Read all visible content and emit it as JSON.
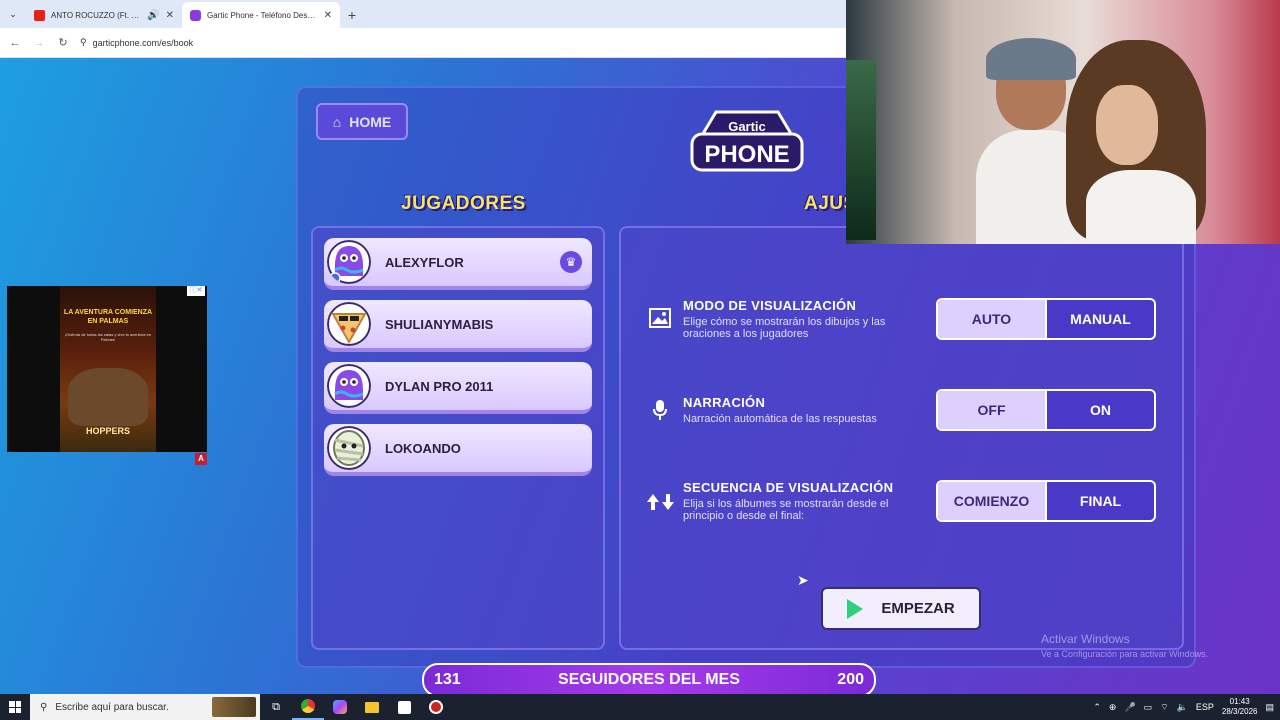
{
  "browser": {
    "tabs": [
      {
        "title": "ANTO ROCUZZO (Ft. Doble",
        "active": false,
        "icon": "youtube-icon"
      },
      {
        "title": "Gartic Phone - Teléfono Descon",
        "active": true,
        "icon": "gartic-icon"
      }
    ],
    "url": "garticphone.com/es/book"
  },
  "game": {
    "home_label": "HOME",
    "logo_line1": "Gartic",
    "logo_line2": "PHONE",
    "players_title": "JUGADORES",
    "settings_title": "AJUS",
    "players": [
      {
        "name": "ALEXYFLOR",
        "host": true
      },
      {
        "name": "SHULIANYMABIS",
        "host": false
      },
      {
        "name": "DYLAN PRO 2011",
        "host": false
      },
      {
        "name": "LOKOANDO",
        "host": false
      }
    ],
    "settings": [
      {
        "title": "MODO DE VISUALIZACIÓN",
        "desc": "Elige cómo se mostrarán los dibujos y las oraciones a los jugadores",
        "options": [
          "AUTO",
          "MANUAL"
        ],
        "selected": "AUTO"
      },
      {
        "title": "NARRACIÓN",
        "desc": "Narración automática de las respuestas",
        "options": [
          "OFF",
          "ON"
        ],
        "selected": "OFF"
      },
      {
        "title": "SECUENCIA DE VISUALIZACIÓN",
        "desc": "Elija si los álbumes se mostrarán desde el principio o desde el final:",
        "options": [
          "COMIENZO",
          "FINAL"
        ],
        "selected": "COMIENZO"
      }
    ],
    "start_label": "EMPEZAR"
  },
  "windows_watermark": {
    "line1": "Activar Windows",
    "line2": "Ve a Configuración para activar Windows."
  },
  "ad": {
    "title": "LA AVENTURA COMIENZA EN PALMAS",
    "subtitle": "¡Disfruta de todas las salas y vive la aventura en Palmas!",
    "brand": "HOPPERS",
    "badge": "A"
  },
  "followers": {
    "current": "131",
    "label": "SEGUIDORES DEL MES",
    "goal": "200"
  },
  "taskbar": {
    "search_placeholder": "Escribe aquí para buscar.",
    "lang": "ESP",
    "time": "01:43",
    "date": "28/3/2026"
  },
  "colors": {
    "accent": "#6a4ae0",
    "title_yellow": "#f2e66a",
    "start_green": "#2fd07a"
  }
}
